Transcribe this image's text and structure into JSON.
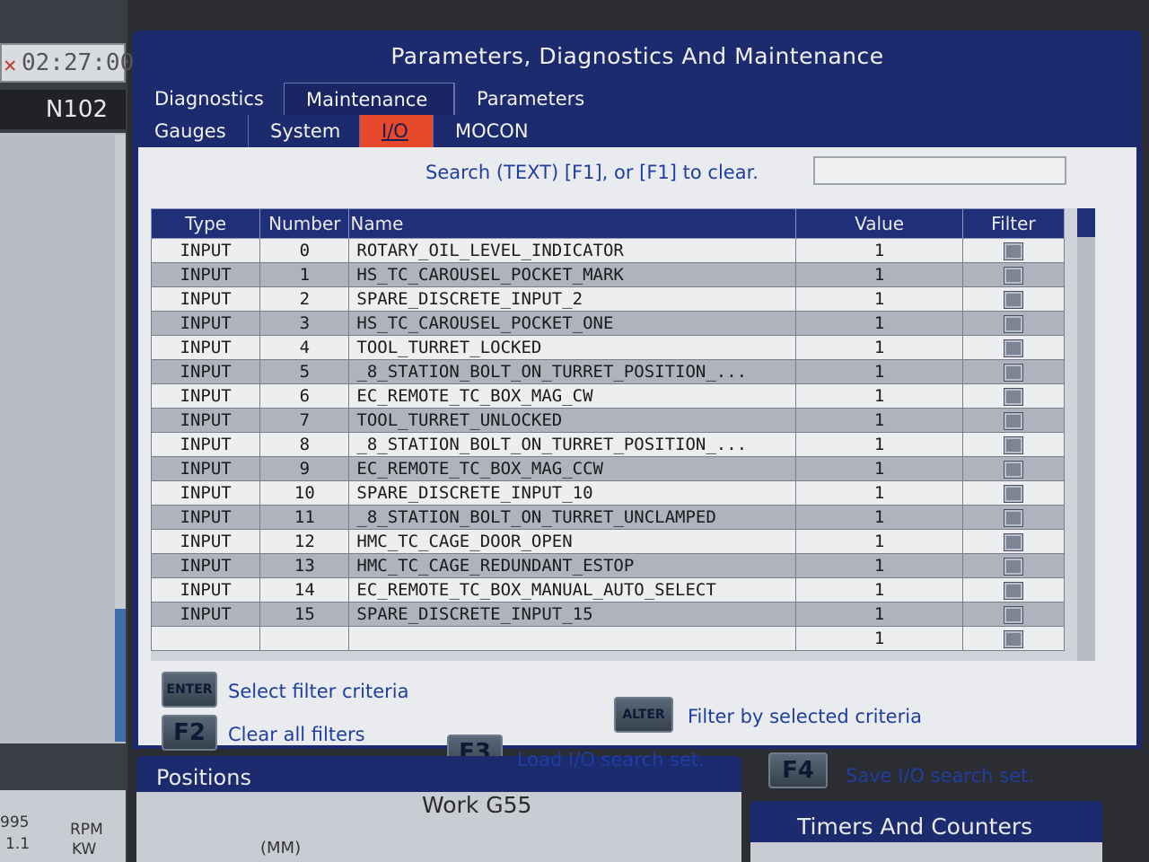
{
  "status": {
    "timer": "02:27:00",
    "nline": "N102",
    "spindle": {
      "rpm_value": "995",
      "rpm_unit": "RPM",
      "kw_value": "1.1",
      "kw_unit": "KW"
    }
  },
  "window": {
    "title": "Parameters, Diagnostics And Maintenance"
  },
  "tabs_top": [
    {
      "label": "Diagnostics"
    },
    {
      "label": "Maintenance"
    },
    {
      "label": "Parameters"
    }
  ],
  "tabs_sub": [
    {
      "label": "Gauges"
    },
    {
      "label": "System"
    },
    {
      "label": "I/O"
    },
    {
      "label": "MOCON"
    }
  ],
  "search": {
    "label": "Search (TEXT) [F1], or [F1] to clear.",
    "value": ""
  },
  "table": {
    "headers": {
      "type": "Type",
      "number": "Number",
      "name": "Name",
      "value": "Value",
      "filter": "Filter"
    },
    "rows": [
      {
        "type": "INPUT",
        "number": "0",
        "name": "ROTARY_OIL_LEVEL_INDICATOR",
        "value": "1"
      },
      {
        "type": "INPUT",
        "number": "1",
        "name": "HS_TC_CAROUSEL_POCKET_MARK",
        "value": "1"
      },
      {
        "type": "INPUT",
        "number": "2",
        "name": "SPARE_DISCRETE_INPUT_2",
        "value": "1"
      },
      {
        "type": "INPUT",
        "number": "3",
        "name": "HS_TC_CAROUSEL_POCKET_ONE",
        "value": "1"
      },
      {
        "type": "INPUT",
        "number": "4",
        "name": "TOOL_TURRET_LOCKED",
        "value": "1"
      },
      {
        "type": "INPUT",
        "number": "5",
        "name": "_8_STATION_BOLT_ON_TURRET_POSITION_...",
        "value": "1"
      },
      {
        "type": "INPUT",
        "number": "6",
        "name": "EC_REMOTE_TC_BOX_MAG_CW",
        "value": "1"
      },
      {
        "type": "INPUT",
        "number": "7",
        "name": "TOOL_TURRET_UNLOCKED",
        "value": "1"
      },
      {
        "type": "INPUT",
        "number": "8",
        "name": "_8_STATION_BOLT_ON_TURRET_POSITION_...",
        "value": "1"
      },
      {
        "type": "INPUT",
        "number": "9",
        "name": "EC_REMOTE_TC_BOX_MAG_CCW",
        "value": "1"
      },
      {
        "type": "INPUT",
        "number": "10",
        "name": "SPARE_DISCRETE_INPUT_10",
        "value": "1"
      },
      {
        "type": "INPUT",
        "number": "11",
        "name": "_8_STATION_BOLT_ON_TURRET_UNCLAMPED",
        "value": "1"
      },
      {
        "type": "INPUT",
        "number": "12",
        "name": "HMC_TC_CAGE_DOOR_OPEN",
        "value": "1"
      },
      {
        "type": "INPUT",
        "number": "13",
        "name": "HMC_TC_CAGE_REDUNDANT_ESTOP",
        "value": "1"
      },
      {
        "type": "INPUT",
        "number": "14",
        "name": "EC_REMOTE_TC_BOX_MANUAL_AUTO_SELECT",
        "value": "1"
      },
      {
        "type": "INPUT",
        "number": "15",
        "name": "SPARE_DISCRETE_INPUT_15",
        "value": "1"
      },
      {
        "type": "",
        "number": "",
        "name": "",
        "value": "1"
      }
    ]
  },
  "hints": {
    "enter_key": "ENTER",
    "enter_text": "Select filter criteria",
    "f2_key": "F2",
    "f2_text": "Clear all filters",
    "f3_key": "F3",
    "f3_text": "Load I/O search set.",
    "alter_key": "ALTER",
    "alter_text": "Filter by selected criteria",
    "f4_key": "F4",
    "f4_text": "Save I/O search set."
  },
  "positions": {
    "title": "Positions",
    "work": "Work G55",
    "unit": "(MM)"
  },
  "timers": {
    "title": "Timers And Counters"
  },
  "colors": {
    "window_blue": "#1c2a6e",
    "active_tab": "#e8492b",
    "hint_blue": "#1f3fa0"
  }
}
